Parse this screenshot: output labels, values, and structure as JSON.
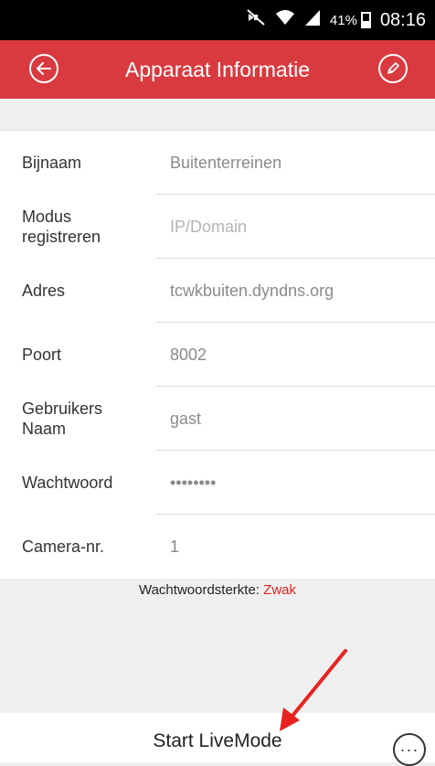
{
  "status_bar": {
    "battery_percent": "41%",
    "time": "08:16"
  },
  "app_bar": {
    "title": "Apparaat Informatie",
    "back_icon": "arrow-left-circle-icon",
    "edit_icon": "pencil-circle-icon"
  },
  "form": {
    "rows": [
      {
        "label": "Bijnaam",
        "value": "Buitenterreinen"
      },
      {
        "label": "Modus registreren",
        "value": "IP/Domain"
      },
      {
        "label": "Adres",
        "value": "tcwkbuiten.dyndns.org"
      },
      {
        "label": "Poort",
        "value": "8002"
      },
      {
        "label": "Gebruikers Naam",
        "value": "gast"
      },
      {
        "label": "Wachtwoord",
        "value": "••••••••"
      },
      {
        "label": "Camera-nr.",
        "value": "1"
      }
    ]
  },
  "password_strength": {
    "label": "Wachtwoordsterkte:",
    "level": "Zwak",
    "level_color": "#e02020"
  },
  "bottom_bar": {
    "start_label": "Start LiveMode",
    "more_label": "···"
  },
  "colors": {
    "app_bar": "#d93a3f",
    "background": "#efefef",
    "annotation_arrow": "#e8231f"
  }
}
